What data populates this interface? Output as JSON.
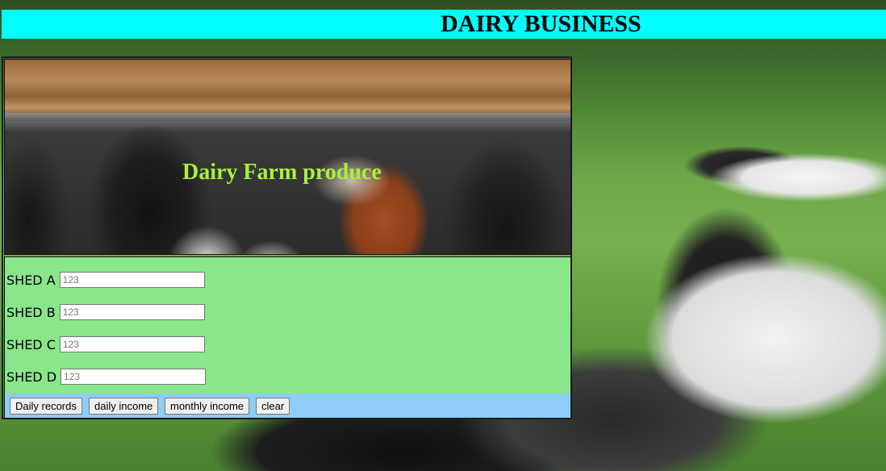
{
  "header": {
    "title": "DAIRY BUSINESS"
  },
  "banner": {
    "caption": "Dairy Farm produce"
  },
  "sheds": [
    {
      "label": "SHED A",
      "placeholder": "123"
    },
    {
      "label": "SHED B",
      "placeholder": "123"
    },
    {
      "label": "SHED C",
      "placeholder": "123"
    },
    {
      "label": "SHED D",
      "placeholder": "123"
    }
  ],
  "actions": {
    "daily_records": "Daily records",
    "daily_income": "daily income",
    "monthly_income": "monthly income",
    "clear": "clear"
  },
  "colors": {
    "title_bar": "#00ffff",
    "form_background": "#8ae68a",
    "button_bar": "#8ecdf8",
    "caption_text": "#a6f23a"
  }
}
